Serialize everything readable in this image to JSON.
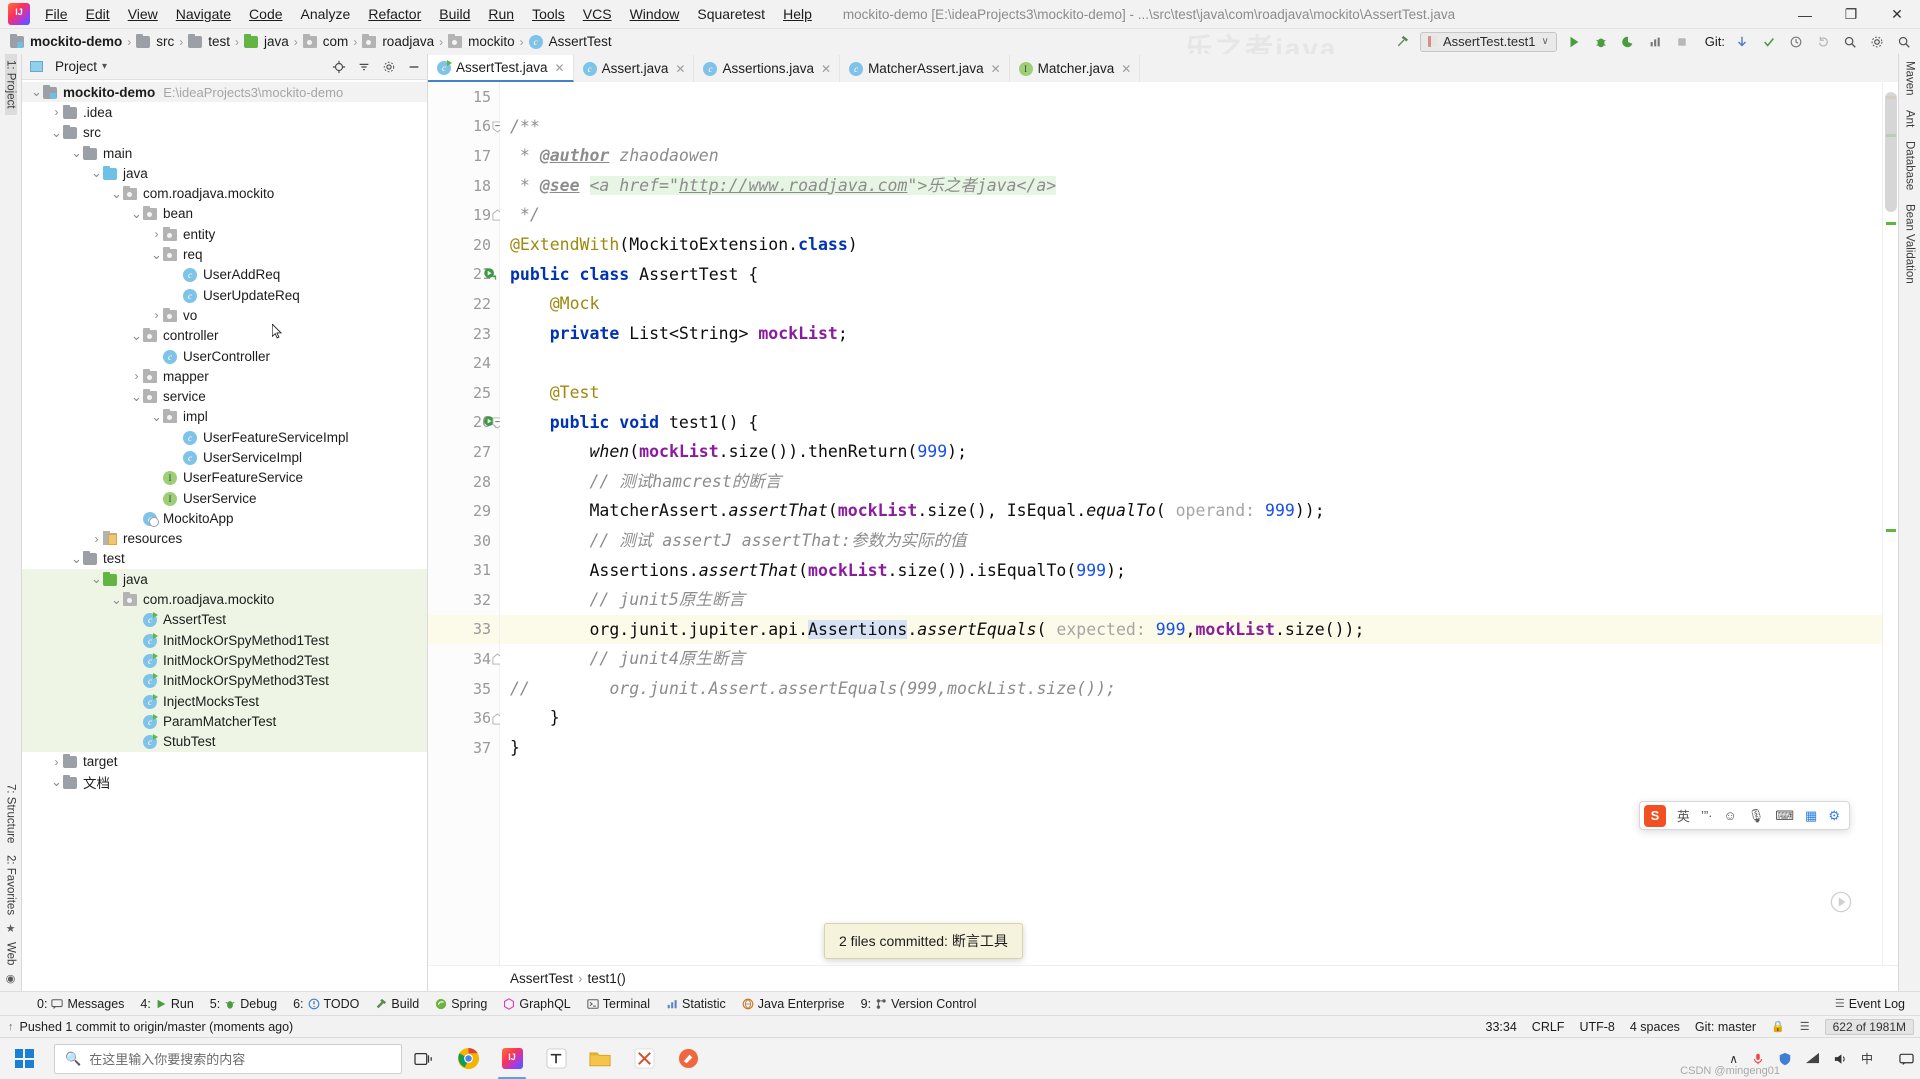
{
  "window": {
    "title": "mockito-demo [E:\\ideaProjects3\\mockito-demo] - ...\\src\\test\\java\\com\\roadjava\\mockito\\AssertTest.java",
    "minimize": "—",
    "maximize": "❐",
    "close": "✕"
  },
  "menu": [
    {
      "label": "File"
    },
    {
      "label": "Edit"
    },
    {
      "label": "View"
    },
    {
      "label": "Navigate"
    },
    {
      "label": "Code"
    },
    {
      "label": "Analyze"
    },
    {
      "label": "Refactor"
    },
    {
      "label": "Build"
    },
    {
      "label": "Run"
    },
    {
      "label": "Tools"
    },
    {
      "label": "VCS"
    },
    {
      "label": "Window"
    },
    {
      "label": "Squaretest"
    },
    {
      "label": "Help"
    }
  ],
  "breadcrumb": {
    "items": [
      "mockito-demo",
      "src",
      "test",
      "java",
      "com",
      "roadjava",
      "mockito",
      "AssertTest"
    ],
    "separator": "›"
  },
  "navbar_right": {
    "run_config": "AssertTest.test1",
    "dropdown_caret": "∨",
    "git_label": "Git:",
    "watermark": "乐之者java"
  },
  "left_rail": {
    "project_tab": "1: Project",
    "structure_tab": "7: Structure",
    "favorites_tab": "2: Favorites",
    "web_tab": "Web"
  },
  "right_rail": {
    "items": [
      "Maven",
      "Ant",
      "Database",
      "Bean Validation"
    ]
  },
  "project_panel": {
    "title": "Project",
    "caret": "▾",
    "root": {
      "label": "mockito-demo",
      "path": "E:\\ideaProjects3\\mockito-demo"
    },
    "tree": [
      {
        "label": "mockito-demo",
        "sub": "E:\\ideaProjects3\\mockito-demo",
        "indent": 0,
        "arrow": "down",
        "icon": "folder-module",
        "bold": true,
        "scope": "root"
      },
      {
        "label": ".idea",
        "indent": 1,
        "arrow": "right",
        "icon": "folder"
      },
      {
        "label": "src",
        "indent": 1,
        "arrow": "down",
        "icon": "folder"
      },
      {
        "label": "main",
        "indent": 2,
        "arrow": "down",
        "icon": "folder"
      },
      {
        "label": "java",
        "indent": 3,
        "arrow": "down",
        "icon": "folder-blue"
      },
      {
        "label": "com.roadjava.mockito",
        "indent": 4,
        "arrow": "down",
        "icon": "package"
      },
      {
        "label": "bean",
        "indent": 5,
        "arrow": "down",
        "icon": "package"
      },
      {
        "label": "entity",
        "indent": 6,
        "arrow": "right",
        "icon": "package"
      },
      {
        "label": "req",
        "indent": 6,
        "arrow": "down",
        "icon": "package"
      },
      {
        "label": "UserAddReq",
        "indent": 7,
        "arrow": "none",
        "icon": "class"
      },
      {
        "label": "UserUpdateReq",
        "indent": 7,
        "arrow": "none",
        "icon": "class"
      },
      {
        "label": "vo",
        "indent": 6,
        "arrow": "right",
        "icon": "package"
      },
      {
        "label": "controller",
        "indent": 5,
        "arrow": "down",
        "icon": "package"
      },
      {
        "label": "UserController",
        "indent": 6,
        "arrow": "none",
        "icon": "class"
      },
      {
        "label": "mapper",
        "indent": 5,
        "arrow": "right",
        "icon": "package"
      },
      {
        "label": "service",
        "indent": 5,
        "arrow": "down",
        "icon": "package"
      },
      {
        "label": "impl",
        "indent": 6,
        "arrow": "down",
        "icon": "package"
      },
      {
        "label": "UserFeatureServiceImpl",
        "indent": 7,
        "arrow": "none",
        "icon": "class"
      },
      {
        "label": "UserServiceImpl",
        "indent": 7,
        "arrow": "none",
        "icon": "class"
      },
      {
        "label": "UserFeatureService",
        "indent": 6,
        "arrow": "none",
        "icon": "interface"
      },
      {
        "label": "UserService",
        "indent": 6,
        "arrow": "none",
        "icon": "interface"
      },
      {
        "label": "MockitoApp",
        "indent": 5,
        "arrow": "none",
        "icon": "class-app"
      },
      {
        "label": "resources",
        "indent": 3,
        "arrow": "right",
        "icon": "resources"
      },
      {
        "label": "test",
        "indent": 2,
        "arrow": "down",
        "icon": "folder"
      },
      {
        "label": "java",
        "indent": 3,
        "arrow": "down",
        "icon": "folder-green",
        "scope": "test"
      },
      {
        "label": "com.roadjava.mockito",
        "indent": 4,
        "arrow": "down",
        "icon": "package",
        "scope": "test"
      },
      {
        "label": "AssertTest",
        "indent": 5,
        "arrow": "none",
        "icon": "class-run",
        "scope": "test"
      },
      {
        "label": "InitMockOrSpyMethod1Test",
        "indent": 5,
        "arrow": "none",
        "icon": "class-run",
        "scope": "test"
      },
      {
        "label": "InitMockOrSpyMethod2Test",
        "indent": 5,
        "arrow": "none",
        "icon": "class-run",
        "scope": "test"
      },
      {
        "label": "InitMockOrSpyMethod3Test",
        "indent": 5,
        "arrow": "none",
        "icon": "class-run",
        "scope": "test"
      },
      {
        "label": "InjectMocksTest",
        "indent": 5,
        "arrow": "none",
        "icon": "class-run",
        "scope": "test"
      },
      {
        "label": "ParamMatcherTest",
        "indent": 5,
        "arrow": "none",
        "icon": "class-run",
        "scope": "test"
      },
      {
        "label": "StubTest",
        "indent": 5,
        "arrow": "none",
        "icon": "class-run",
        "scope": "test"
      },
      {
        "label": "target",
        "indent": 1,
        "arrow": "right",
        "icon": "folder"
      },
      {
        "label": "文档",
        "indent": 1,
        "arrow": "down",
        "icon": "folder"
      }
    ]
  },
  "editor": {
    "tabs": [
      {
        "label": "AssertTest.java",
        "icon": "class-run",
        "active": true,
        "close": "✕"
      },
      {
        "label": "Assert.java",
        "icon": "class",
        "active": false,
        "close": "✕"
      },
      {
        "label": "Assertions.java",
        "icon": "class",
        "active": false,
        "close": "✕"
      },
      {
        "label": "MatcherAssert.java",
        "icon": "class",
        "active": false,
        "close": "✕"
      },
      {
        "label": "Matcher.java",
        "icon": "interface",
        "active": false,
        "close": "✕"
      }
    ],
    "first_line_number": 15,
    "highlighted_line": 33,
    "lines": [
      {
        "n": 15,
        "text": ""
      },
      {
        "n": 16,
        "text": "/**",
        "fold": "collapse"
      },
      {
        "n": 17,
        "text": " * @author zhaodaowen"
      },
      {
        "n": 18,
        "text": " * @see <a href=\"http://www.roadjava.com\">乐之者java</a>"
      },
      {
        "n": 19,
        "text": " */",
        "fold": "end"
      },
      {
        "n": 20,
        "text": "@ExtendWith(MockitoExtension.class)"
      },
      {
        "n": 21,
        "text": "public class AssertTest {",
        "marker": "run"
      },
      {
        "n": 22,
        "text": "    @Mock"
      },
      {
        "n": 23,
        "text": "    private List<String> mockList;"
      },
      {
        "n": 24,
        "text": ""
      },
      {
        "n": 25,
        "text": "    @Test"
      },
      {
        "n": 26,
        "text": "    public void test1() {",
        "marker": "run",
        "fold": "collapse"
      },
      {
        "n": 27,
        "text": "        when(mockList.size()).thenReturn(999);"
      },
      {
        "n": 28,
        "text": "        // 测试hamcrest的断言"
      },
      {
        "n": 29,
        "text": "        MatcherAssert.assertThat(mockList.size(), IsEqual.equalTo( operand: 999));"
      },
      {
        "n": 30,
        "text": "        // 测试 assertJ assertThat:参数为实际的值"
      },
      {
        "n": 31,
        "text": "        Assertions.assertThat(mockList.size()).isEqualTo(999);"
      },
      {
        "n": 32,
        "text": "        // junit5原生断言"
      },
      {
        "n": 33,
        "text": "        org.junit.jupiter.api.Assertions.assertEquals( expected: 999,mockList.size());"
      },
      {
        "n": 34,
        "text": "        // junit4原生断言",
        "fold": "end"
      },
      {
        "n": 35,
        "text": "//        org.junit.Assert.assertEquals(999,mockList.size());"
      },
      {
        "n": 36,
        "text": "    }",
        "fold": "end"
      },
      {
        "n": 37,
        "text": "}"
      }
    ],
    "param_hints": {
      "operand": "operand:",
      "expected": "expected:"
    },
    "footer_breadcrumb": [
      "AssertTest",
      "test1()"
    ],
    "footer_separator": "›"
  },
  "toast": {
    "message": "2 files committed: 断言工具"
  },
  "ime": {
    "logo": "S",
    "mode": "英",
    "punct": "’”·",
    "emoji": "☺",
    "mic": "🎙",
    "keyboard": "⌨",
    "grid": "▦",
    "settings": "⚙"
  },
  "tool_windows": {
    "left": [
      {
        "num": "0:",
        "label": "Messages",
        "icon": "message-icon"
      },
      {
        "num": "4:",
        "label": "Run",
        "icon": "run-icon"
      },
      {
        "num": "5:",
        "label": "Debug",
        "icon": "debug-icon"
      },
      {
        "num": "6:",
        "label": "TODO",
        "icon": "todo-icon"
      },
      {
        "num": "",
        "label": "Build",
        "icon": "build-icon"
      },
      {
        "num": "",
        "label": "Spring",
        "icon": "spring-icon"
      },
      {
        "num": "",
        "label": "GraphQL",
        "icon": "graphql-icon"
      },
      {
        "num": "",
        "label": "Terminal",
        "icon": "terminal-icon"
      },
      {
        "num": "",
        "label": "Statistic",
        "icon": "statistic-icon"
      },
      {
        "num": "",
        "label": "Java Enterprise",
        "icon": "java-ee-icon"
      },
      {
        "num": "9:",
        "label": "Version Control",
        "icon": "vcs-icon"
      }
    ],
    "right": [
      {
        "label": "Event Log",
        "icon": "event-log-icon"
      }
    ]
  },
  "status_bar": {
    "message": "Pushed 1 commit to origin/master (moments ago)",
    "caret_position": "33:34",
    "line_separator": "CRLF",
    "encoding": "UTF-8",
    "indent": "4 spaces",
    "branch": "Git: master",
    "memory": "622 of 1981M",
    "lock_icon": "🔒"
  },
  "taskbar": {
    "search_placeholder": "在这里输入你要搜索的内容",
    "search_icon": "🔍",
    "apps": [
      {
        "name": "task-view",
        "glyph": "▭"
      },
      {
        "name": "chrome",
        "glyph": "●"
      },
      {
        "name": "intellij-idea",
        "glyph": "IJ",
        "active": true
      },
      {
        "name": "typora",
        "glyph": "T"
      },
      {
        "name": "file-explorer",
        "glyph": "📁"
      },
      {
        "name": "xmind",
        "glyph": "✕"
      },
      {
        "name": "postman",
        "glyph": "◉"
      }
    ],
    "tray": {
      "chevron": "∧",
      "mic": "🎙",
      "shield": "⬟",
      "network": "◰",
      "volume": "🔊",
      "ime": "中",
      "clock_time": "",
      "notification": "💬"
    },
    "watermark": "CSDN @mingeng01"
  },
  "colors": {
    "accent": "#4083c9",
    "test_scope": "#eef5e4",
    "highlight_line": "#fcfae8",
    "keyword": "#0033b3",
    "field": "#8a1c9e",
    "number": "#1750eb",
    "comment": "#8c8c8c",
    "annotation": "#9e880d",
    "string": "#067d17"
  }
}
